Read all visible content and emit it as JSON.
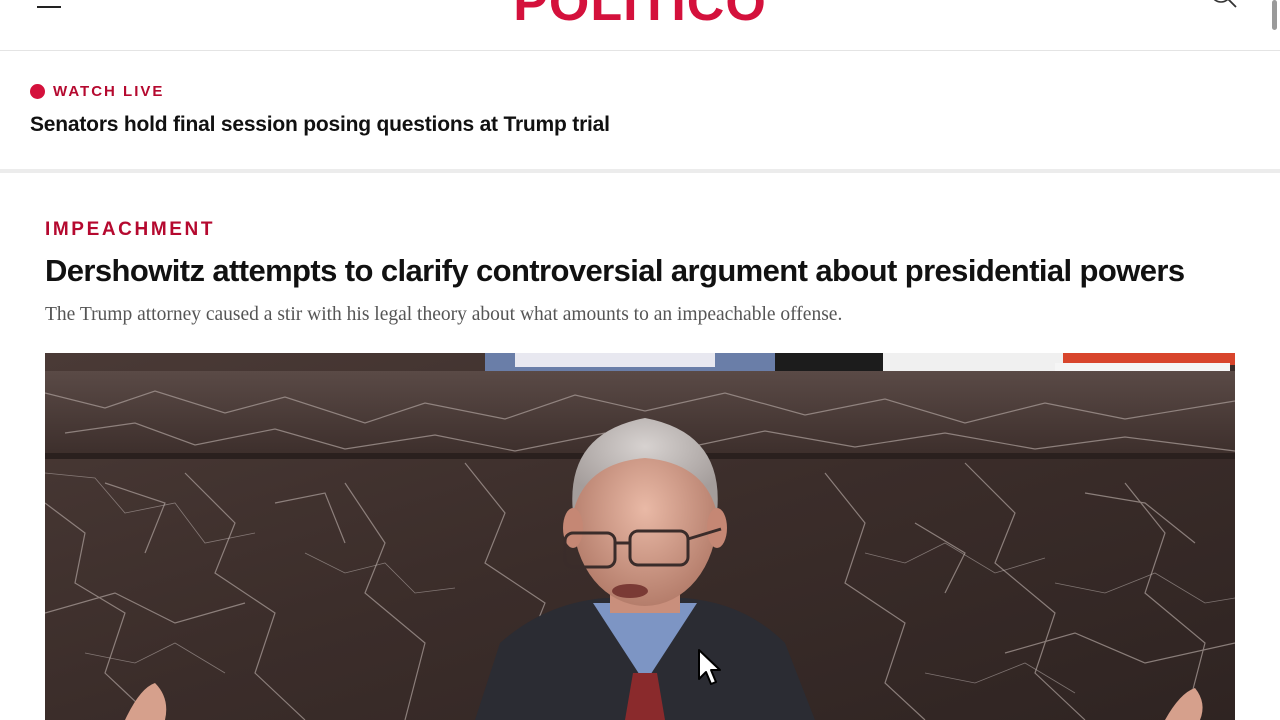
{
  "header": {
    "logo_text": "POLITICO",
    "menu_icon": "hamburger-menu-icon",
    "search_icon": "search-icon",
    "brand_color": "#d4113c"
  },
  "live_banner": {
    "label": "WATCH LIVE",
    "headline": "Senators hold final session posing questions at Trump trial",
    "dot_color": "#d4113c"
  },
  "story": {
    "kicker": "IMPEACHMENT",
    "headline": "Dershowitz attempts to clarify controversial argument about presidential powers",
    "dek": "The Trump attorney caused a stir with his legal theory about what amounts to an impeachable offense."
  }
}
